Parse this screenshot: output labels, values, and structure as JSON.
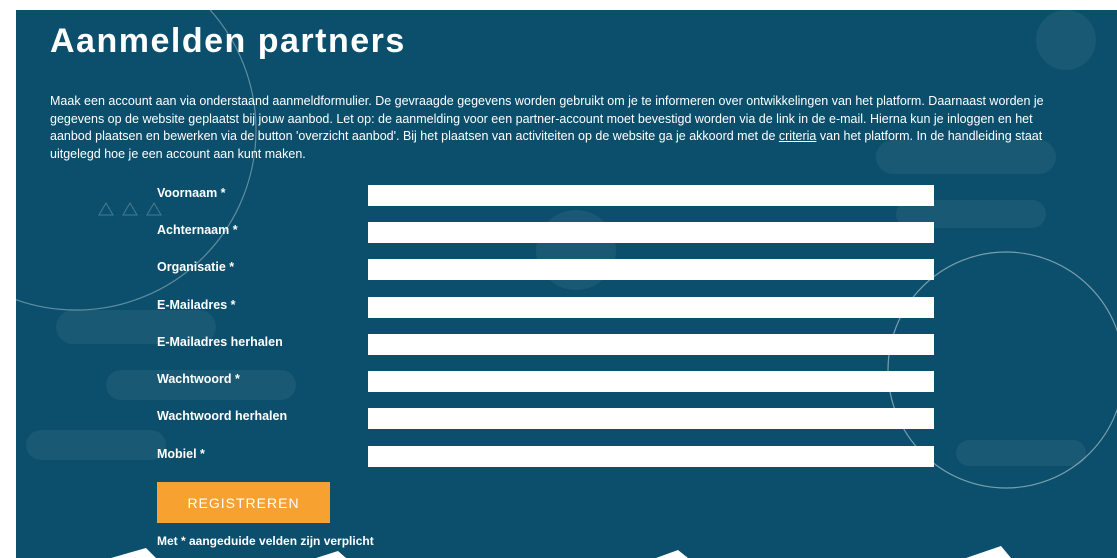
{
  "page": {
    "title": "Aanmelden partners",
    "intro_before_link": "Maak  een account aan via onderstaand aanmeldformulier. De gevraagde gegevens worden gebruikt om je te informeren over ontwikkelingen van het platform. Daarnaast worden je gegevens op de website geplaatst bij jouw aanbod. Let op: de aanmelding voor een partner-account moet bevestigd worden via de link in de e-mail. Hierna kun je inloggen en het aanbod plaatsen en bewerken via de button 'overzicht aanbod'. Bij het plaatsen van activiteiten op de website ga je akkoord met de ",
    "intro_link": "criteria",
    "intro_after_link": " van het platform. In de handleiding staat uitgelegd hoe je een account aan kunt maken."
  },
  "form": {
    "fields": [
      {
        "label": "Voornaam *",
        "value": ""
      },
      {
        "label": "Achternaam *",
        "value": ""
      },
      {
        "label": "Organisatie *",
        "value": ""
      },
      {
        "label": "E-Mailadres *",
        "value": ""
      },
      {
        "label": "E-Mailadres herhalen",
        "value": ""
      },
      {
        "label": "Wachtwoord *",
        "value": ""
      },
      {
        "label": "Wachtwoord herhalen",
        "value": ""
      },
      {
        "label": "Mobiel *",
        "value": ""
      }
    ],
    "submit_label": "REGISTREREN",
    "required_note": "Met * aangeduide velden zijn verplicht"
  },
  "colors": {
    "background": "#0b4f6c",
    "button": "#f7a131",
    "text": "#ffffff"
  }
}
